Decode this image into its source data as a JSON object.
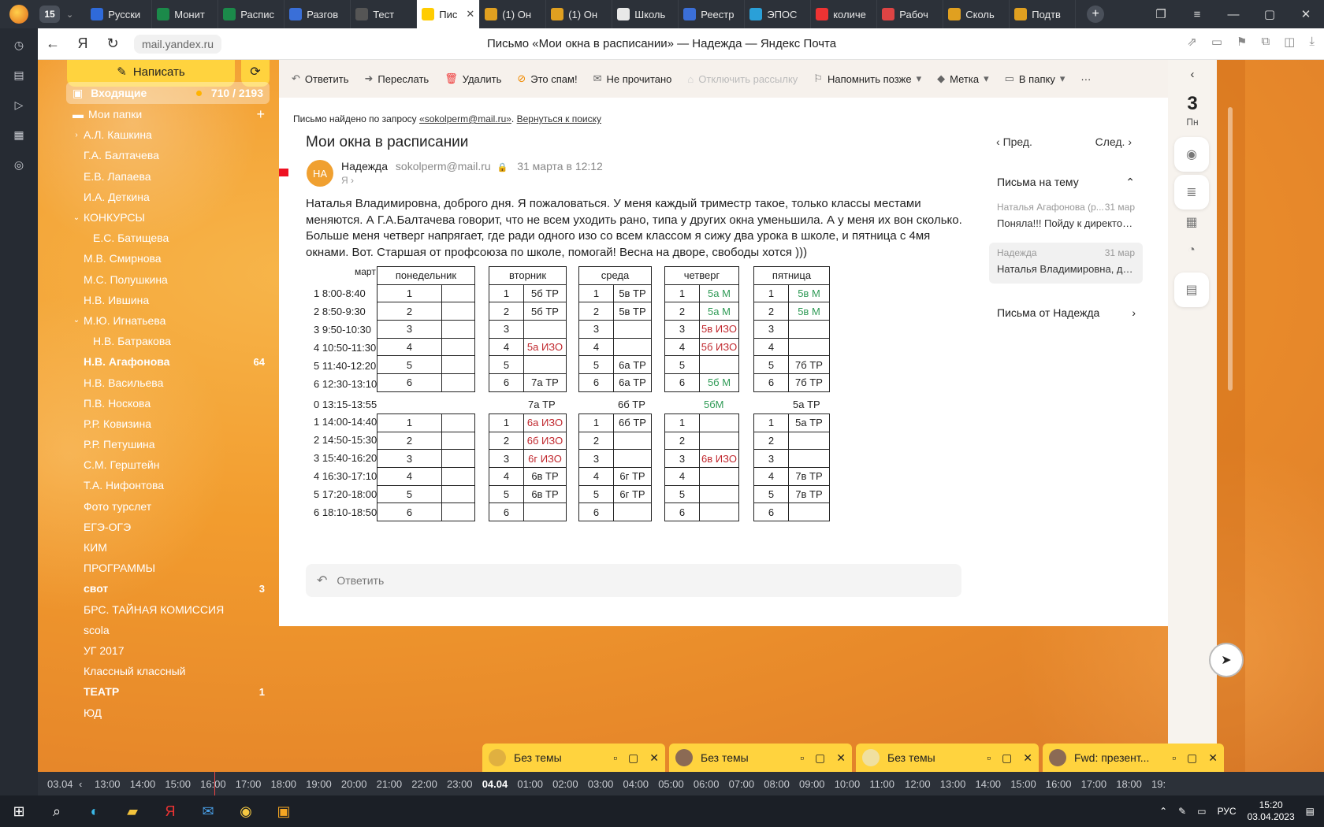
{
  "browser": {
    "tab_count": "15",
    "tabs": [
      {
        "label": "Русски",
        "icon": "doc-icon",
        "color": "#2f6ad9"
      },
      {
        "label": "Монит",
        "icon": "sheets-icon",
        "color": "#1b8a4a"
      },
      {
        "label": "Распис",
        "icon": "sheets-icon",
        "color": "#1b8a4a"
      },
      {
        "label": "Разгов",
        "icon": "pb-icon",
        "color": "#3a6fd8"
      },
      {
        "label": "Тест",
        "icon": "page-icon",
        "color": "#555555"
      },
      {
        "label": "Пис",
        "icon": "mail-icon",
        "color": "#ffcc00",
        "active": true
      },
      {
        "label": "(1) Он",
        "icon": "shield-icon",
        "color": "#e0a020"
      },
      {
        "label": "(1) Он",
        "icon": "shield-icon",
        "color": "#e0a020"
      },
      {
        "label": "Школь",
        "icon": "school-icon",
        "color": "#e8e8e8"
      },
      {
        "label": "Реестр",
        "icon": "feather-icon",
        "color": "#3b6fd8"
      },
      {
        "label": "ЭПОС",
        "icon": "globe-icon",
        "color": "#2aa0d8"
      },
      {
        "label": "количе",
        "icon": "yandex-icon",
        "color": "#e33"
      },
      {
        "label": "Рабоч",
        "icon": "circle-icon",
        "color": "#d44"
      },
      {
        "label": "Сколь",
        "icon": "shield-icon",
        "color": "#e0a020"
      },
      {
        "label": "Подтв",
        "icon": "shield-icon",
        "color": "#e0a020"
      }
    ],
    "url": "mail.yandex.ru",
    "page_title": "Письмо «Мои окна в расписании» — Надежда — Яндекс Почта"
  },
  "sidebar": {
    "compose_label": "Написать",
    "inbox_label": "Входящие",
    "inbox_count": "710 / 2193",
    "folders": [
      {
        "label": "Мои папки",
        "add": "+",
        "indent": 0,
        "arrow": ""
      },
      {
        "label": "А.Л. Кашкина",
        "indent": 1,
        "arrow": "›"
      },
      {
        "label": "Г.А. Балтачева",
        "indent": 1,
        "arrow": ""
      },
      {
        "label": "Е.В. Лапаева",
        "indent": 1,
        "arrow": ""
      },
      {
        "label": "И.А. Деткина",
        "indent": 1,
        "arrow": ""
      },
      {
        "label": "КОНКУРСЫ",
        "indent": 1,
        "arrow": "⌄"
      },
      {
        "label": "Е.С. Батищева",
        "indent": 2,
        "arrow": ""
      },
      {
        "label": "М.В. Смирнова",
        "indent": 1,
        "arrow": ""
      },
      {
        "label": "М.С. Полушкина",
        "indent": 1,
        "arrow": ""
      },
      {
        "label": "Н.В. Ившина",
        "indent": 1,
        "arrow": ""
      },
      {
        "label": "М.Ю. Игнатьева",
        "indent": 1,
        "arrow": "⌄"
      },
      {
        "label": "Н.В. Батракова",
        "indent": 2,
        "arrow": ""
      },
      {
        "label": "Н.В. Агафонова",
        "indent": 1,
        "arrow": "",
        "bold": true,
        "badge": "64"
      },
      {
        "label": "Н.В. Васильева",
        "indent": 1,
        "arrow": ""
      },
      {
        "label": "П.В. Носкова",
        "indent": 1,
        "arrow": ""
      },
      {
        "label": "Р.Р. Ковизина",
        "indent": 1,
        "arrow": ""
      },
      {
        "label": "Р.Р. Петушина",
        "indent": 1,
        "arrow": ""
      },
      {
        "label": "С.М. Герштейн",
        "indent": 1,
        "arrow": ""
      },
      {
        "label": "Т.А. Нифонтова",
        "indent": 1,
        "arrow": ""
      },
      {
        "label": "Фото турслет",
        "indent": 1,
        "arrow": ""
      },
      {
        "label": "ЕГЭ-ОГЭ",
        "indent": 1,
        "arrow": ""
      },
      {
        "label": "КИМ",
        "indent": 1,
        "arrow": ""
      },
      {
        "label": "ПРОГРАММЫ",
        "indent": 1,
        "arrow": ""
      },
      {
        "label": "свот",
        "indent": 1,
        "arrow": "",
        "bold": true,
        "badge": "3"
      },
      {
        "label": "БРС. ТАЙНАЯ КОМИССИЯ",
        "indent": 1,
        "arrow": ""
      },
      {
        "label": "scola",
        "indent": 1,
        "arrow": ""
      },
      {
        "label": "УГ 2017",
        "indent": 1,
        "arrow": ""
      },
      {
        "label": "Классный классный",
        "indent": 1,
        "arrow": ""
      },
      {
        "label": "ТЕАТР",
        "indent": 1,
        "arrow": "",
        "bold": true,
        "badge": "1"
      },
      {
        "label": "ЮД",
        "indent": 1,
        "arrow": ""
      }
    ]
  },
  "toolbar": {
    "reply": "Ответить",
    "forward": "Переслать",
    "delete": "Удалить",
    "spam": "Это спам!",
    "unread": "Не прочитано",
    "unsubscribe": "Отключить рассылку",
    "remind": "Напомнить позже",
    "label": "Метка",
    "to_folder": "В папку",
    "more": "···"
  },
  "message": {
    "found_prefix": "Письмо найдено по запросу",
    "found_query": "«sokolperm@mail.ru»",
    "back_to_search": "Вернуться к поиску",
    "subject": "Мои окна в расписании",
    "avatar_initials": "НА",
    "sender_name": "Надежда",
    "sender_email": "sokolperm@mail.ru",
    "date": "31 марта в 12:12",
    "to": "Я ›",
    "body": "Наталья Владимировна, доброго дня. Я пожаловаться. У меня каждый триместр такое, только классы местами меняются. А Г.А.Балтачева говорит, что не всем уходить рано, типа у других окна уменьшила. А у меня их вон сколько. Больше меня четверг напрягает, где ради одного изо со всем классом я сижу два урока в школе, и пятница с 4мя окнами. Вот. Старшая от профсоюза по школе, помогай! Весна на дворе, свободы хотся )))",
    "reply_placeholder": "Ответить"
  },
  "schedule": {
    "month": "март",
    "days": [
      "понедельник",
      "вторник",
      "среда",
      "четверг",
      "пятница"
    ],
    "times_am": [
      "1  8:00-8:40",
      "2  8:50-9:30",
      "3  9:50-10:30",
      "4 10:50-11:30",
      "5 11:40-12:20",
      "6 12:30-13:10"
    ],
    "break_time": "0 13:15-13:55",
    "times_pm": [
      "1 14:00-14:40",
      "2 14:50-15:30",
      "3 15:40-16:20",
      "4 16:30-17:10",
      "5 17:20-18:00",
      "6 18:10-18:50"
    ],
    "am": {
      "mon": [
        "",
        "",
        "",
        "",
        "",
        ""
      ],
      "tue": [
        "5б ТР",
        "5б ТР",
        "",
        "5а ИЗО",
        "",
        "7а ТР"
      ],
      "wed": [
        "5в ТР",
        "5в ТР",
        "",
        "",
        "6а ТР",
        "6а ТР"
      ],
      "thu": [
        "5а М",
        "5а М",
        "5в ИЗО",
        "5б ИЗО",
        "",
        "5б М"
      ],
      "fri": [
        "5в М",
        "5в М",
        "",
        "",
        "7б ТР",
        "7б ТР"
      ]
    },
    "break": {
      "tue": "7а ТР",
      "wed": "6б ТР",
      "thu": "5бМ",
      "fri": "5а ТР"
    },
    "pm": {
      "mon": [
        "",
        "",
        "",
        "",
        "",
        ""
      ],
      "tue": [
        "6а ИЗО",
        "6б ИЗО",
        "6г ИЗО",
        "6в ТР",
        "6в ТР",
        ""
      ],
      "wed": [
        "6б ТР",
        "",
        "",
        "6г ТР",
        "6г ТР",
        ""
      ],
      "thu": [
        "",
        "",
        "6в ИЗО",
        "",
        "",
        ""
      ],
      "fri": [
        "5а ТР",
        "",
        "",
        "7в ТР",
        "7в ТР",
        ""
      ]
    },
    "colors": {
      "red": "#c0272d",
      "green": "#2e9a55"
    }
  },
  "thread": {
    "prev": "Пред.",
    "next": "След.",
    "title": "Письма на тему",
    "items": [
      {
        "from": "Наталья Агафонова (р...",
        "date": "31 мар",
        "preview": "Поняла!!! Пойду к директору..."
      },
      {
        "from": "Надежда",
        "date": "31 мар",
        "preview": "Наталья Владимировна, добр...",
        "selected": true
      }
    ],
    "from_her": "Письма от Надежда"
  },
  "calendar": {
    "day": "3",
    "weekday": "Пн"
  },
  "drafts": [
    "Без темы",
    "Без темы",
    "Без темы",
    "Fwd: презент..."
  ],
  "timeline": {
    "date_start": "03.04",
    "ticks": [
      "13:00",
      "14:00",
      "15:00",
      "16:00",
      "17:00",
      "18:00",
      "19:00",
      "20:00",
      "21:00",
      "22:00",
      "23:00",
      "04.04",
      "01:00",
      "02:00",
      "03:00",
      "04:00",
      "05:00",
      "06:00",
      "07:00",
      "08:00",
      "09:00",
      "10:00",
      "11:00",
      "12:00",
      "13:00",
      "14:00",
      "15:00",
      "16:00",
      "17:00",
      "18:00",
      "19:"
    ]
  },
  "taskbar": {
    "lang": "РУС",
    "time": "15:20",
    "date": "03.04.2023"
  }
}
